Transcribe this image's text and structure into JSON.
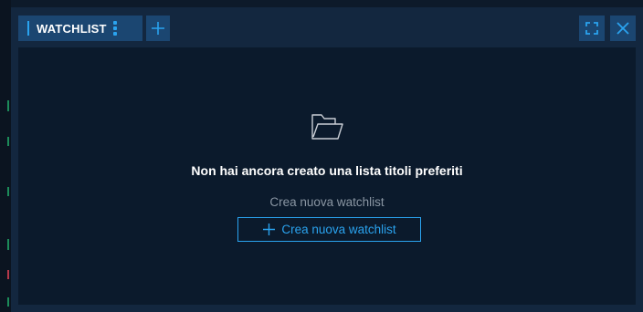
{
  "tab": {
    "label": "WATCHLIST"
  },
  "empty_state": {
    "title": "Non hai ancora creato una lista titoli preferiti",
    "subtitle": "Crea nuova watchlist",
    "button_label": "Crea nuova watchlist"
  },
  "colors": {
    "accent": "#2aa3ef",
    "panel": "#13273f",
    "content": "#0b1a2c",
    "tab": "#1b4671"
  },
  "icons": [
    "kebab-menu-icon",
    "plus-icon",
    "expand-icon",
    "close-icon",
    "folder-open-icon"
  ]
}
